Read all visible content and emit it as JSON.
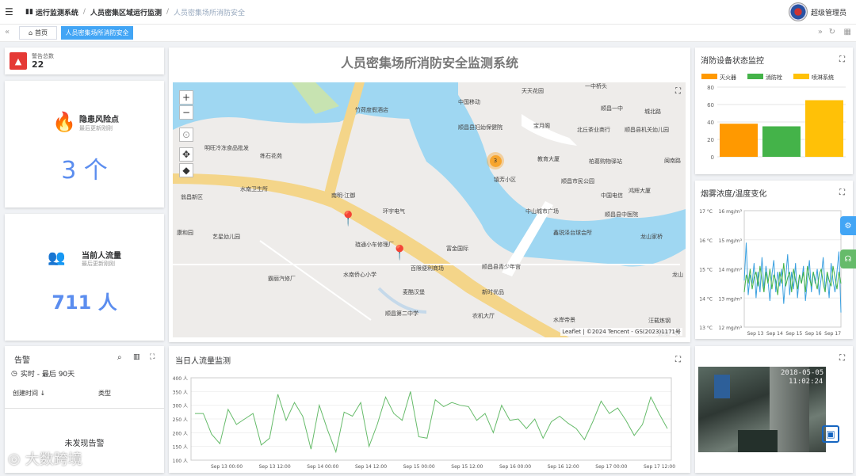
{
  "breadcrumb": {
    "root": "运行监测系统",
    "mid": "人员密集区域运行监测",
    "current": "人员密集场所消防安全"
  },
  "user": {
    "name": "超级管理员"
  },
  "tabs": [
    {
      "label": "首页"
    },
    {
      "label": "人员密集场所消防安全"
    }
  ],
  "alarm_total": {
    "label": "警告总数",
    "value": "22"
  },
  "hazard": {
    "title": "隐患风险点",
    "sub": "最后更新刚刚",
    "value": "3 个"
  },
  "flow": {
    "title": "当前人流量",
    "sub": "最后更新刚刚",
    "value": "711 人"
  },
  "main_title": "人员密集场所消防安全监测系统",
  "map": {
    "cluster": "3",
    "attribution": "Leaflet | ©2024 Tencent - GS(2023)1171号",
    "labels": [
      "竹荷度假酒店",
      "中国移动",
      "天天花园",
      "一中桥头",
      "顺昌一中",
      "城北路",
      "顺昌县妇幼保健院",
      "宝月阁",
      "北丘茶业商行",
      "顺昌县机关幼儿园",
      "明旺冷冻食品批发",
      "练石花苑",
      "教育大厦",
      "柏葛购物驿站",
      "镇芳小区",
      "顺昌市民公园",
      "闽南路",
      "中国电信",
      "鸿辉大厦",
      "水南卫生所",
      "南明·江御",
      "环宇电气",
      "中山城市广场",
      "顺昌县中医院",
      "龙山家桥",
      "翁昌新区",
      "康和园",
      "艺星幼儿园",
      "琏通小车修理厂",
      "富金国际",
      "顺昌县青少年宫",
      "霸丽汽修厂",
      "水南侨心小学",
      "百限便利商场",
      "新时优品",
      "麦酷汉堡",
      "顺昌第二中学",
      "农机大厅",
      "水岸帝景",
      "汪载炼钢",
      "造纸厂职",
      "鑫锐泽台球会所",
      "龙山"
    ]
  },
  "equipment": {
    "title": "消防设备状态监控",
    "chart_data": {
      "type": "bar",
      "categories": [
        "灭火器",
        "消防栓",
        "喷淋系统"
      ],
      "values": [
        38,
        35,
        65
      ],
      "colors": [
        "#ff9900",
        "#44b349",
        "#ffc107"
      ],
      "ylim": [
        0,
        80
      ],
      "yticks": [
        0,
        20,
        40,
        60,
        80
      ],
      "legend": "top"
    }
  },
  "smoke": {
    "title": "烟雾浓度/温度变化",
    "chart_data": {
      "type": "line",
      "x": [
        "Sep 13",
        "Sep 14",
        "Sep 15",
        "Sep 16",
        "Sep 17"
      ],
      "y_left_ticks": [
        "17 °C",
        "16 °C",
        "15 °C",
        "14 °C",
        "13 °C"
      ],
      "y_right_ticks": [
        "16 mg/m³",
        "15 mg/m³",
        "14 mg/m³",
        "13 mg/m³",
        "12 mg/m³"
      ],
      "series": [
        {
          "color": "#3aa0e0",
          "values": [
            14.6,
            15.9,
            14.1,
            14.8,
            14.5,
            15.2,
            14.0,
            14.9,
            14.2,
            15.4,
            14.3,
            15.1,
            14.6,
            13.9,
            14.8,
            15.3,
            14.2,
            14.9,
            14.4,
            15.0,
            13.8,
            14.7,
            15.5,
            14.1,
            14.9,
            14.3,
            15.2,
            14.0,
            14.8,
            14.5,
            15.1,
            13.9,
            14.6,
            15.3,
            14.2,
            14.9,
            14.5,
            15.0,
            14.1,
            14.7,
            15.4,
            14.3,
            14.8,
            14.0,
            15.2,
            14.6,
            14.2,
            14.9,
            15.6,
            13.5
          ]
        },
        {
          "color": "#44b349",
          "values": [
            14.2,
            14.8,
            14.5,
            15.0,
            14.3,
            14.7,
            14.9,
            14.4,
            15.1,
            14.6,
            14.2,
            14.9,
            14.5,
            15.0,
            14.3,
            14.8,
            14.6,
            14.1,
            14.9,
            14.5,
            15.2,
            14.4,
            14.7,
            14.9,
            14.2,
            15.0,
            14.6,
            14.3,
            14.8,
            14.5,
            14.9,
            14.2,
            15.1,
            14.7,
            14.4,
            14.9,
            14.6,
            14.3,
            14.8,
            15.0,
            14.5,
            14.2,
            14.9,
            14.6,
            14.4,
            15.1,
            14.7,
            14.3,
            14.9,
            14.5
          ]
        }
      ]
    }
  },
  "alerts": {
    "title": "告警",
    "time_range": "实时 - 最后 90天",
    "col_time": "创建时间",
    "col_type": "类型",
    "empty": "未发现告警"
  },
  "traffic": {
    "title": "当日人流量监测",
    "chart_data": {
      "type": "line",
      "color": "#66bb6a",
      "x_ticks": [
        "Sep 13 00:00",
        "Sep 13 12:00",
        "Sep 14 00:00",
        "Sep 14 12:00",
        "Sep 15 00:00",
        "Sep 15 12:00",
        "Sep 16 00:00",
        "Sep 16 12:00",
        "Sep 17 00:00",
        "Sep 17 12:00"
      ],
      "y_ticks": [
        "400 人",
        "350 人",
        "300 人",
        "250 人",
        "200 人",
        "150 人",
        "100 人"
      ],
      "ylim": [
        100,
        400
      ],
      "values": [
        270,
        270,
        195,
        160,
        285,
        230,
        250,
        270,
        155,
        180,
        340,
        245,
        310,
        260,
        140,
        300,
        210,
        130,
        275,
        260,
        310,
        150,
        230,
        330,
        270,
        245,
        350,
        185,
        180,
        320,
        295,
        310,
        300,
        295,
        245,
        270,
        200,
        300,
        245,
        250,
        215,
        250,
        180,
        240,
        260,
        235,
        215,
        175,
        240,
        315,
        270,
        290,
        245,
        190,
        230,
        330,
        270,
        215
      ]
    }
  },
  "camera": {
    "timestamp": "2018-05-05",
    "time": "11:02:24"
  },
  "watermark": "大数跨境"
}
